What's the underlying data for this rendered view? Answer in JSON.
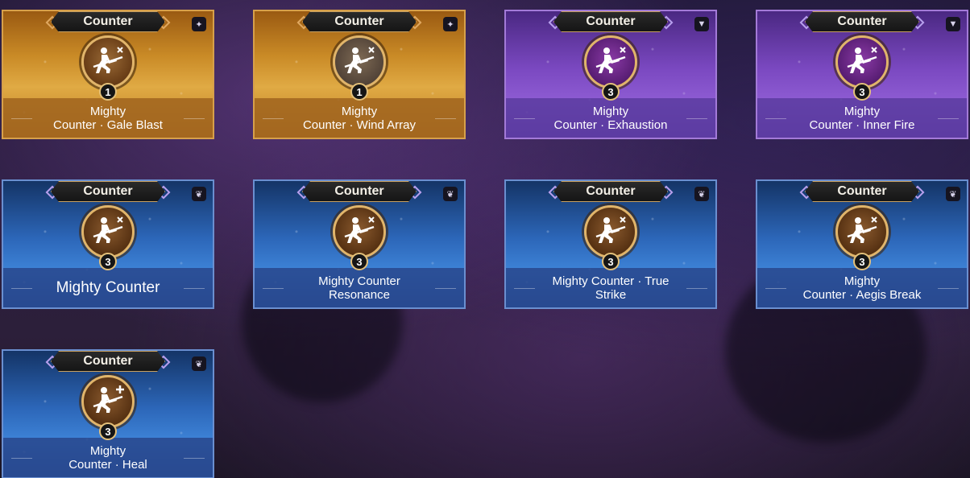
{
  "colors": {
    "gold": "#d7a04a",
    "purple": "#8d5bd2",
    "blue": "#3e84d8"
  },
  "cards": [
    {
      "tag": "Counter",
      "level": "1",
      "name_line1": "Mighty",
      "name_line2": "Counter · Gale Blast",
      "rarity": "gold",
      "icon": "counter-strike-icon",
      "badge": "gem-icon"
    },
    {
      "tag": "Counter",
      "level": "1",
      "name_line1": "Mighty",
      "name_line2": "Counter · Wind Array",
      "rarity": "gold",
      "icon": "counter-strike-icon",
      "badge": "gem-icon"
    },
    {
      "tag": "Counter",
      "level": "3",
      "name_line1": "Mighty",
      "name_line2": "Counter · Exhaustion",
      "rarity": "purple",
      "icon": "counter-strike-icon",
      "badge": "triangle-icon"
    },
    {
      "tag": "Counter",
      "level": "3",
      "name_line1": "Mighty",
      "name_line2": "Counter · Inner Fire",
      "rarity": "purple",
      "icon": "counter-strike-icon",
      "badge": "triangle-icon"
    },
    {
      "tag": "Counter",
      "level": "3",
      "name_line1": "Mighty Counter",
      "name_line2": "",
      "rarity": "blue",
      "icon": "counter-strike-icon",
      "badge": "wings-icon"
    },
    {
      "tag": "Counter",
      "level": "3",
      "name_line1": "Mighty Counter",
      "name_line2": "Resonance",
      "rarity": "blue",
      "icon": "counter-strike-icon",
      "badge": "wings-icon"
    },
    {
      "tag": "Counter",
      "level": "3",
      "name_line1": "Mighty Counter · True",
      "name_line2": "Strike",
      "rarity": "blue",
      "icon": "counter-strike-icon",
      "badge": "wings-icon"
    },
    {
      "tag": "Counter",
      "level": "3",
      "name_line1": "Mighty",
      "name_line2": "Counter · Aegis Break",
      "rarity": "blue",
      "icon": "counter-strike-icon",
      "badge": "wings-icon"
    },
    {
      "tag": "Counter",
      "level": "3",
      "name_line1": "Mighty",
      "name_line2": "Counter · Heal",
      "rarity": "blue",
      "icon": "counter-heal-icon",
      "badge": "wings-icon"
    }
  ]
}
